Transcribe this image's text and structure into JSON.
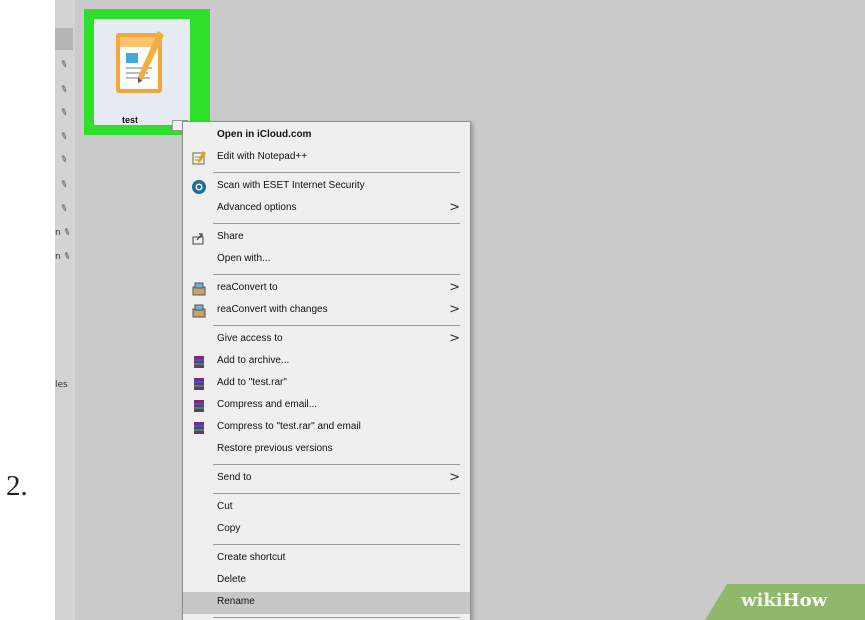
{
  "step": {
    "number": "2."
  },
  "file": {
    "name": "test"
  },
  "nav_fragments": [
    "n",
    "n",
    "les"
  ],
  "menu": {
    "items": [
      {
        "label": "Open in iCloud.com",
        "bold": true,
        "icon": "none"
      },
      {
        "label": "Edit with Notepad++",
        "icon": "notepad-icon"
      },
      {
        "label": "Scan with ESET Internet Security",
        "icon": "eset-icon"
      },
      {
        "label": "Advanced options",
        "icon": "none",
        "submenu": true
      },
      {
        "label": "Share",
        "icon": "share-icon"
      },
      {
        "label": "Open with...",
        "icon": "none"
      },
      {
        "label": "reaConvert to",
        "icon": "reaconvert-icon",
        "submenu": true
      },
      {
        "label": "reaConvert with changes",
        "icon": "reaconvert-icon",
        "submenu": true
      },
      {
        "label": "Give access to",
        "icon": "none",
        "submenu": true
      },
      {
        "label": "Add to archive...",
        "icon": "winrar-icon"
      },
      {
        "label": "Add to \"test.rar\"",
        "icon": "winrar-icon"
      },
      {
        "label": "Compress and email...",
        "icon": "winrar-icon"
      },
      {
        "label": "Compress to \"test.rar\" and email",
        "icon": "winrar-icon"
      },
      {
        "label": "Restore previous versions",
        "icon": "none"
      },
      {
        "label": "Send to",
        "icon": "none",
        "submenu": true
      },
      {
        "label": "Cut",
        "icon": "none"
      },
      {
        "label": "Copy",
        "icon": "none"
      },
      {
        "label": "Create shortcut",
        "icon": "none"
      },
      {
        "label": "Delete",
        "icon": "none"
      },
      {
        "label": "Rename",
        "icon": "none",
        "highlighted": true
      }
    ],
    "submenu_arrow": ">"
  },
  "watermark": {
    "wiki": "wiki",
    "how": "How"
  },
  "colors": {
    "highlight_box": "#2ee02c",
    "menu_bg": "#efefef",
    "hover": "#c7c7c7"
  }
}
